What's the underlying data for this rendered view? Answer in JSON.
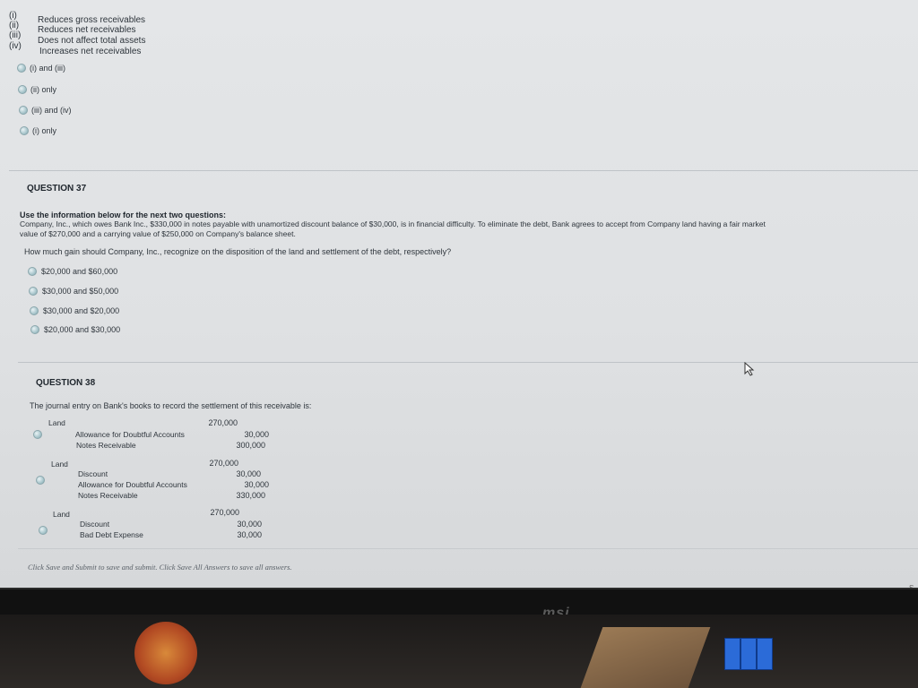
{
  "previous_question": {
    "statements": [
      {
        "roman": "(i)",
        "text": "Reduces gross receivables"
      },
      {
        "roman": "(ii)",
        "text": "Reduces net receivables"
      },
      {
        "roman": "(iii)",
        "text": "Does not affect total assets"
      },
      {
        "roman": "(iv)",
        "text": "Increases net receivables"
      }
    ],
    "options": [
      "(i) and (iii)",
      "(ii) only",
      "(iii) and (iv)",
      "(i) only"
    ]
  },
  "q37": {
    "title": "QUESTION 37",
    "intro": "Use the information below for the next two questions:",
    "body_line1": "Company, Inc., which owes Bank Inc., $330,000 in notes payable with unamortized discount balance of $30,000, is in financial difficulty. To eliminate the debt, Bank agrees to accept from Company land having a fair market",
    "body_line2": "value of $270,000 and a carrying value of $250,000 on Company's balance sheet.",
    "prompt": "How much gain should Company, Inc., recognize on the disposition of the land and settlement of the debt, respectively?",
    "options": [
      "$20,000 and $60,000",
      "$30,000 and $50,000",
      "$30,000 and $20,000",
      "$20,000 and $30,000"
    ]
  },
  "q38": {
    "title": "QUESTION 38",
    "prompt": "The journal entry on Bank's books to record the settlement of this receivable is:",
    "options": [
      {
        "debit_label": "Land",
        "debit_value": "270,000",
        "credits": [
          {
            "label": "Allowance for Doubtful Accounts",
            "value": "30,000"
          },
          {
            "label": "Notes Receivable",
            "value": "300,000"
          }
        ]
      },
      {
        "debit_label": "Land",
        "debit_value": "270,000",
        "credits": [
          {
            "label": "Discount",
            "value": "30,000"
          },
          {
            "label": "Allowance for Doubtful Accounts",
            "value": "30,000"
          },
          {
            "label": "Notes Receivable",
            "value": "330,000"
          }
        ]
      },
      {
        "debit_label": "Land",
        "debit_value": "270,000",
        "credits": [
          {
            "label": "Discount",
            "value": "30,000"
          },
          {
            "label": "Bad Debt Expense",
            "value": "30,000"
          }
        ]
      }
    ]
  },
  "footer": {
    "note": "Click Save and Submit to save and submit. Click Save All Answers to save all answers.",
    "corner_text": "S"
  },
  "monitor": {
    "brand": "msi"
  }
}
